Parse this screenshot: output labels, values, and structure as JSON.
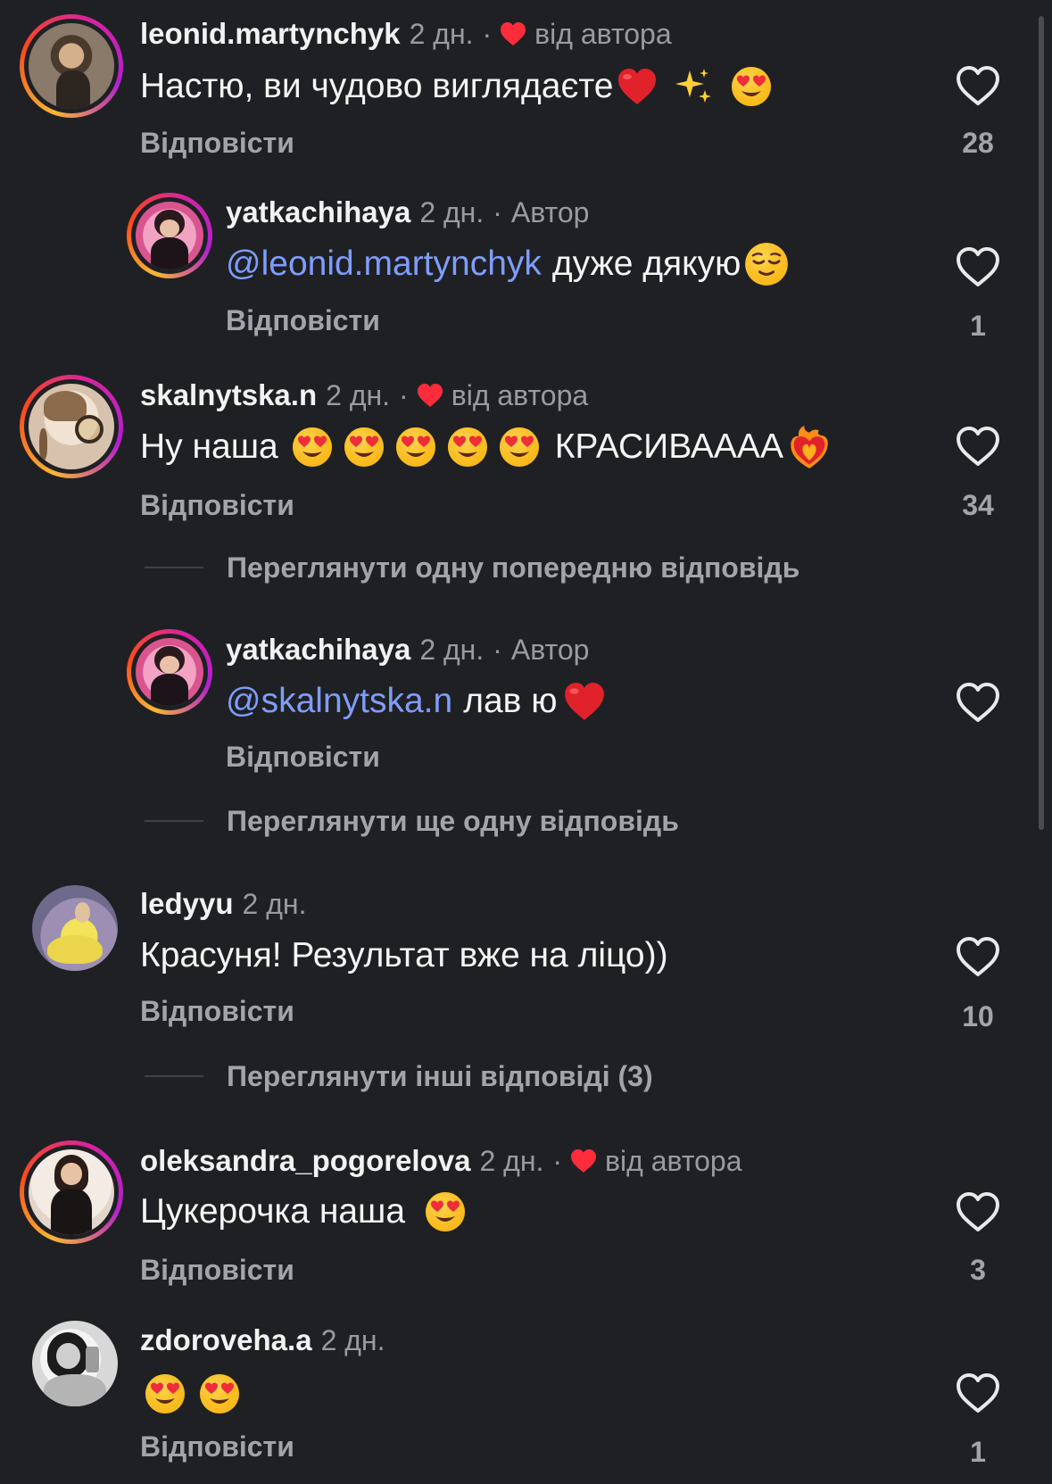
{
  "comments": [
    {
      "username": "leonid.martynchyk",
      "time": "2 дн.",
      "separator": "·",
      "author_tag": "від автора",
      "text": "Настю, ви чудово виглядаєте",
      "reply": "Відповісти",
      "likes": "28"
    },
    {
      "username": "yatkachihaya",
      "time": "2 дн.",
      "separator": "·",
      "author_tag": "Автор",
      "mention": "@leonid.martynchyk",
      "text": "дуже дякую",
      "reply": "Відповісти",
      "likes": "1"
    },
    {
      "username": "skalnytska.n",
      "time": "2 дн.",
      "separator": "·",
      "author_tag": "від автора",
      "text_before": "Ну наша",
      "text_after": "КРАСИВАААА",
      "reply": "Відповісти",
      "likes": "34",
      "view_more": "Переглянути одну попередню відповідь"
    },
    {
      "username": "yatkachihaya",
      "time": "2 дн.",
      "separator": "·",
      "author_tag": "Автор",
      "mention": "@skalnytska.n",
      "text": "лав ю",
      "reply": "Відповісти",
      "view_more": "Переглянути ще одну відповідь"
    },
    {
      "username": "ledyyu",
      "time": "2 дн.",
      "text": "Красуня! Результат вже на ліцо))",
      "reply": "Відповісти",
      "likes": "10",
      "view_more": "Переглянути інші відповіді (3)"
    },
    {
      "username": "oleksandra_pogorelova",
      "time": "2 дн.",
      "separator": "·",
      "author_tag": "від автора",
      "text": "Цукерочка наша",
      "reply": "Відповісти",
      "likes": "3"
    },
    {
      "username": "zdoroveha.a",
      "time": "2 дн.",
      "reply": "Відповісти",
      "likes": "1"
    }
  ],
  "icons": {
    "like": "heart-outline-icon",
    "author_like": "heart-filled-icon",
    "emoji_love": "heart-eyes-emoji",
    "emoji_relieved": "relieved-face-emoji",
    "emoji_sparkles": "sparkles-emoji",
    "emoji_red_heart": "red-heart-emoji",
    "emoji_heart_fire": "heart-on-fire-emoji"
  },
  "colors": {
    "background": "#1f2024",
    "mention": "#7f9cff",
    "secondary_text": "#9a9ba1",
    "author_heart": "#ff2d3b"
  }
}
